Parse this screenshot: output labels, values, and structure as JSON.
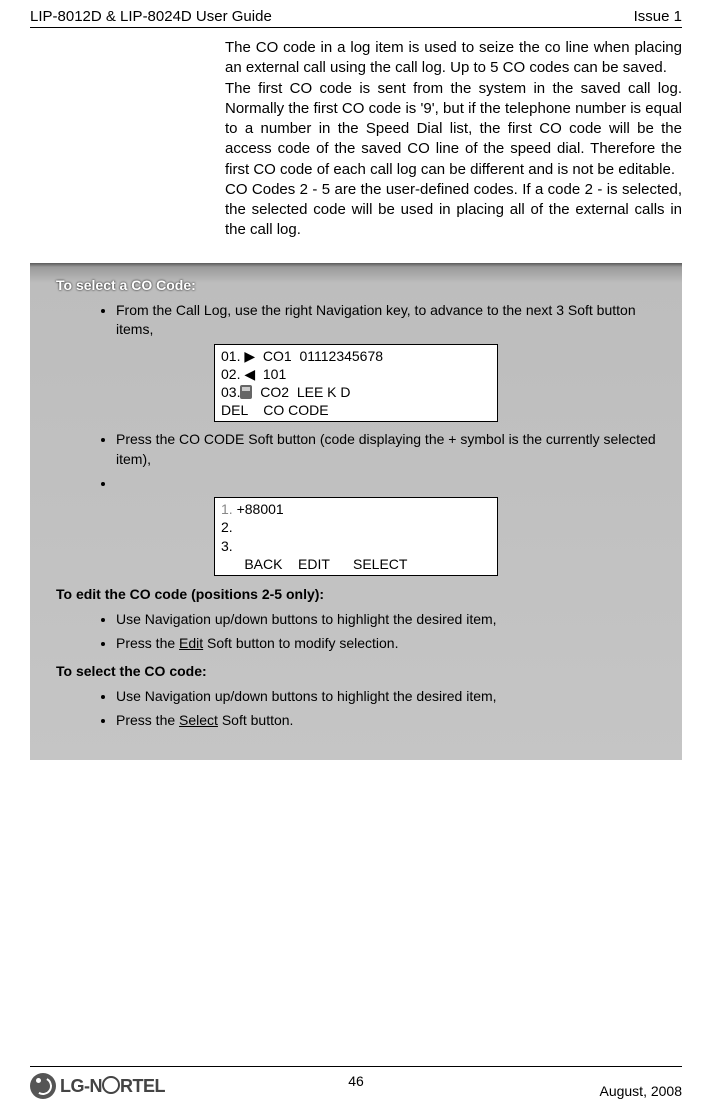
{
  "header": {
    "left": "LIP-8012D & LIP-8024D User Guide",
    "right": "Issue 1"
  },
  "paragraphs": {
    "p1": "The CO code in a log item is used to seize the co line when placing an external call using the call log. Up to 5 CO codes can be saved.",
    "p2": "The first CO code is sent from the system in the saved call log. Normally the first CO code is '9', but if the telephone number is equal to a number in the Speed Dial list, the first CO code will be the access code of the saved CO line of the speed dial. Therefore the first CO code of each call log can be different and is not be editable.",
    "p3": "CO Codes 2 - 5 are the user-defined codes. If a code 2 - is selected, the selected code will be used in placing all of the external calls in the call log."
  },
  "box": {
    "head1": "To select a CO Code:",
    "b1": "From the Call Log, use the right Navigation key, to advance to the next 3 Soft button items,",
    "screen1": {
      "l1": "01. ▶  CO1  01112345678",
      "l2": "02. ◀  101",
      "l3a": "03.",
      "l3b": "  CO2  LEE K D",
      "l4": "DEL    CO CODE"
    },
    "b2": "Press the CO CODE Soft button (code displaying the + symbol is the currently selected item),",
    "screen2": {
      "l1a": "1.",
      "l1b": " +88001",
      "l2": "2.",
      "l3": "3.",
      "l4": "      BACK    EDIT      SELECT"
    },
    "head2": "To edit the CO code (positions 2-5 only):",
    "e1": "Use Navigation up/down buttons to highlight the desired item,",
    "e2a": "Press the ",
    "e2link": "Edit",
    "e2b": " Soft button to modify selection.",
    "head3": "To select the CO code:",
    "s1": "Use Navigation up/down buttons to highlight the desired item,",
    "s2a": "Press the ",
    "s2link": "Select",
    "s2b": " Soft button."
  },
  "footer": {
    "logo_text_a": "LG-N",
    "logo_text_b": "RTEL",
    "page": "46",
    "date": "August, 2008"
  }
}
